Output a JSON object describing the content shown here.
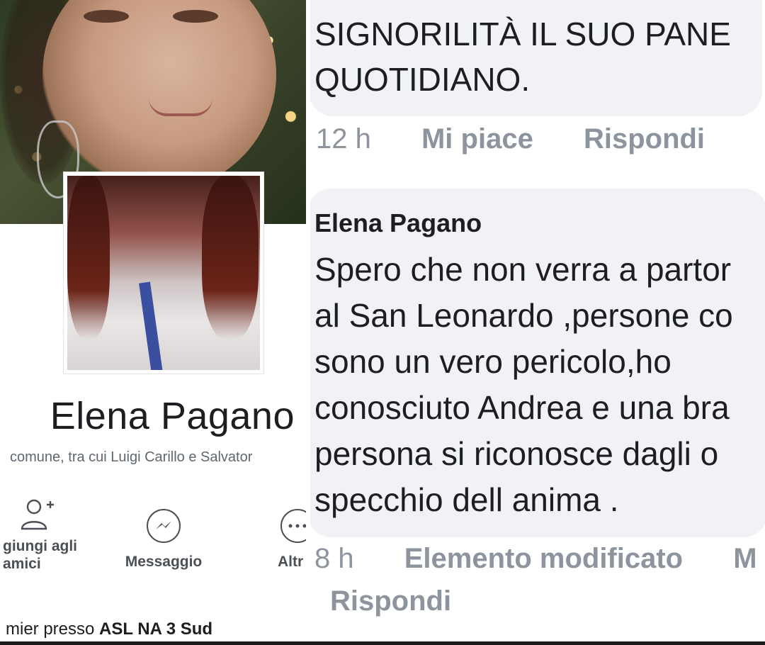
{
  "profile": {
    "name": "Elena Pagano",
    "mutual_friends": "comune, tra cui Luigi Carillo e Salvator",
    "actions": {
      "add_friend": "giungi agli amici",
      "message": "Messaggio",
      "more": "Altr"
    },
    "workplace_prefix": "mier presso ",
    "workplace_name": "ASL NA 3 Sud"
  },
  "comments": [
    {
      "text_lines": [
        "SIGNORILITÀ IL SUO PANE",
        "QUOTIDIANO."
      ],
      "time": "12 h",
      "like": "Mi piace",
      "reply": "Rispondi"
    },
    {
      "author": "Elena Pagano",
      "text_lines": [
        "Spero che non verra a partor",
        "al San Leonardo ,persone co",
        "sono un vero pericolo,ho",
        "conosciuto Andrea e una bra",
        "persona si riconosce dagli o",
        "specchio dell anima ."
      ],
      "time": "8 h",
      "edited": "Elemento modificato",
      "like_cut": "M",
      "reply": "Rispondi"
    }
  ],
  "colors": {
    "text": "#1c1e21",
    "muted": "#8d949e",
    "bubble": "#f0f2f5",
    "lanyard": "#3b4fa0"
  },
  "icons": [
    "add-friend-icon",
    "messenger-icon",
    "more-icon"
  ]
}
